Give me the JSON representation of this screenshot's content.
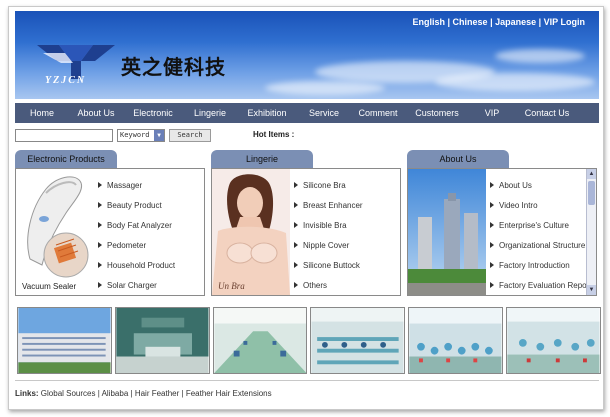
{
  "header": {
    "languages": [
      "English",
      "Chinese",
      "Japanese",
      "VIP Login"
    ],
    "logo_text": "YZJCN",
    "company_name": "英之健科技"
  },
  "nav": {
    "items": [
      "Home",
      "About Us",
      "Electronic",
      "Lingerie",
      "Exhibition",
      "Service",
      "Comment",
      "Customers",
      "VIP",
      "Contact Us"
    ]
  },
  "search": {
    "value": "",
    "select_value": "Keyword",
    "button_label": "Search",
    "hot_items_label": "Hot Items :"
  },
  "panels": {
    "electronic": {
      "title": "Electronic Products",
      "items": [
        "Massager",
        "Beauty Product",
        "Body Fat Analyzer",
        "Pedometer",
        "Household Product",
        "Solar Charger"
      ],
      "image_caption": "Vacuum Sealer"
    },
    "lingerie": {
      "title": "Lingerie",
      "items": [
        "Silicone Bra",
        "Breast Enhancer",
        "Invisible Bra",
        "Nipple Cover",
        "Silicone Buttock",
        "Others"
      ],
      "image_caption": "Un Bra"
    },
    "about": {
      "title": "About  Us",
      "items": [
        "About Us",
        "Video Intro",
        "Enterprise's Culture",
        "Organizational Structure",
        "Factory Introduction",
        "Factory Evaluation Repo"
      ]
    }
  },
  "footer": {
    "label": "Links:",
    "links": [
      "Global Sources",
      "Alibaba",
      "Hair Feather",
      "Feather Hair Extensions"
    ],
    "separator": " | "
  }
}
